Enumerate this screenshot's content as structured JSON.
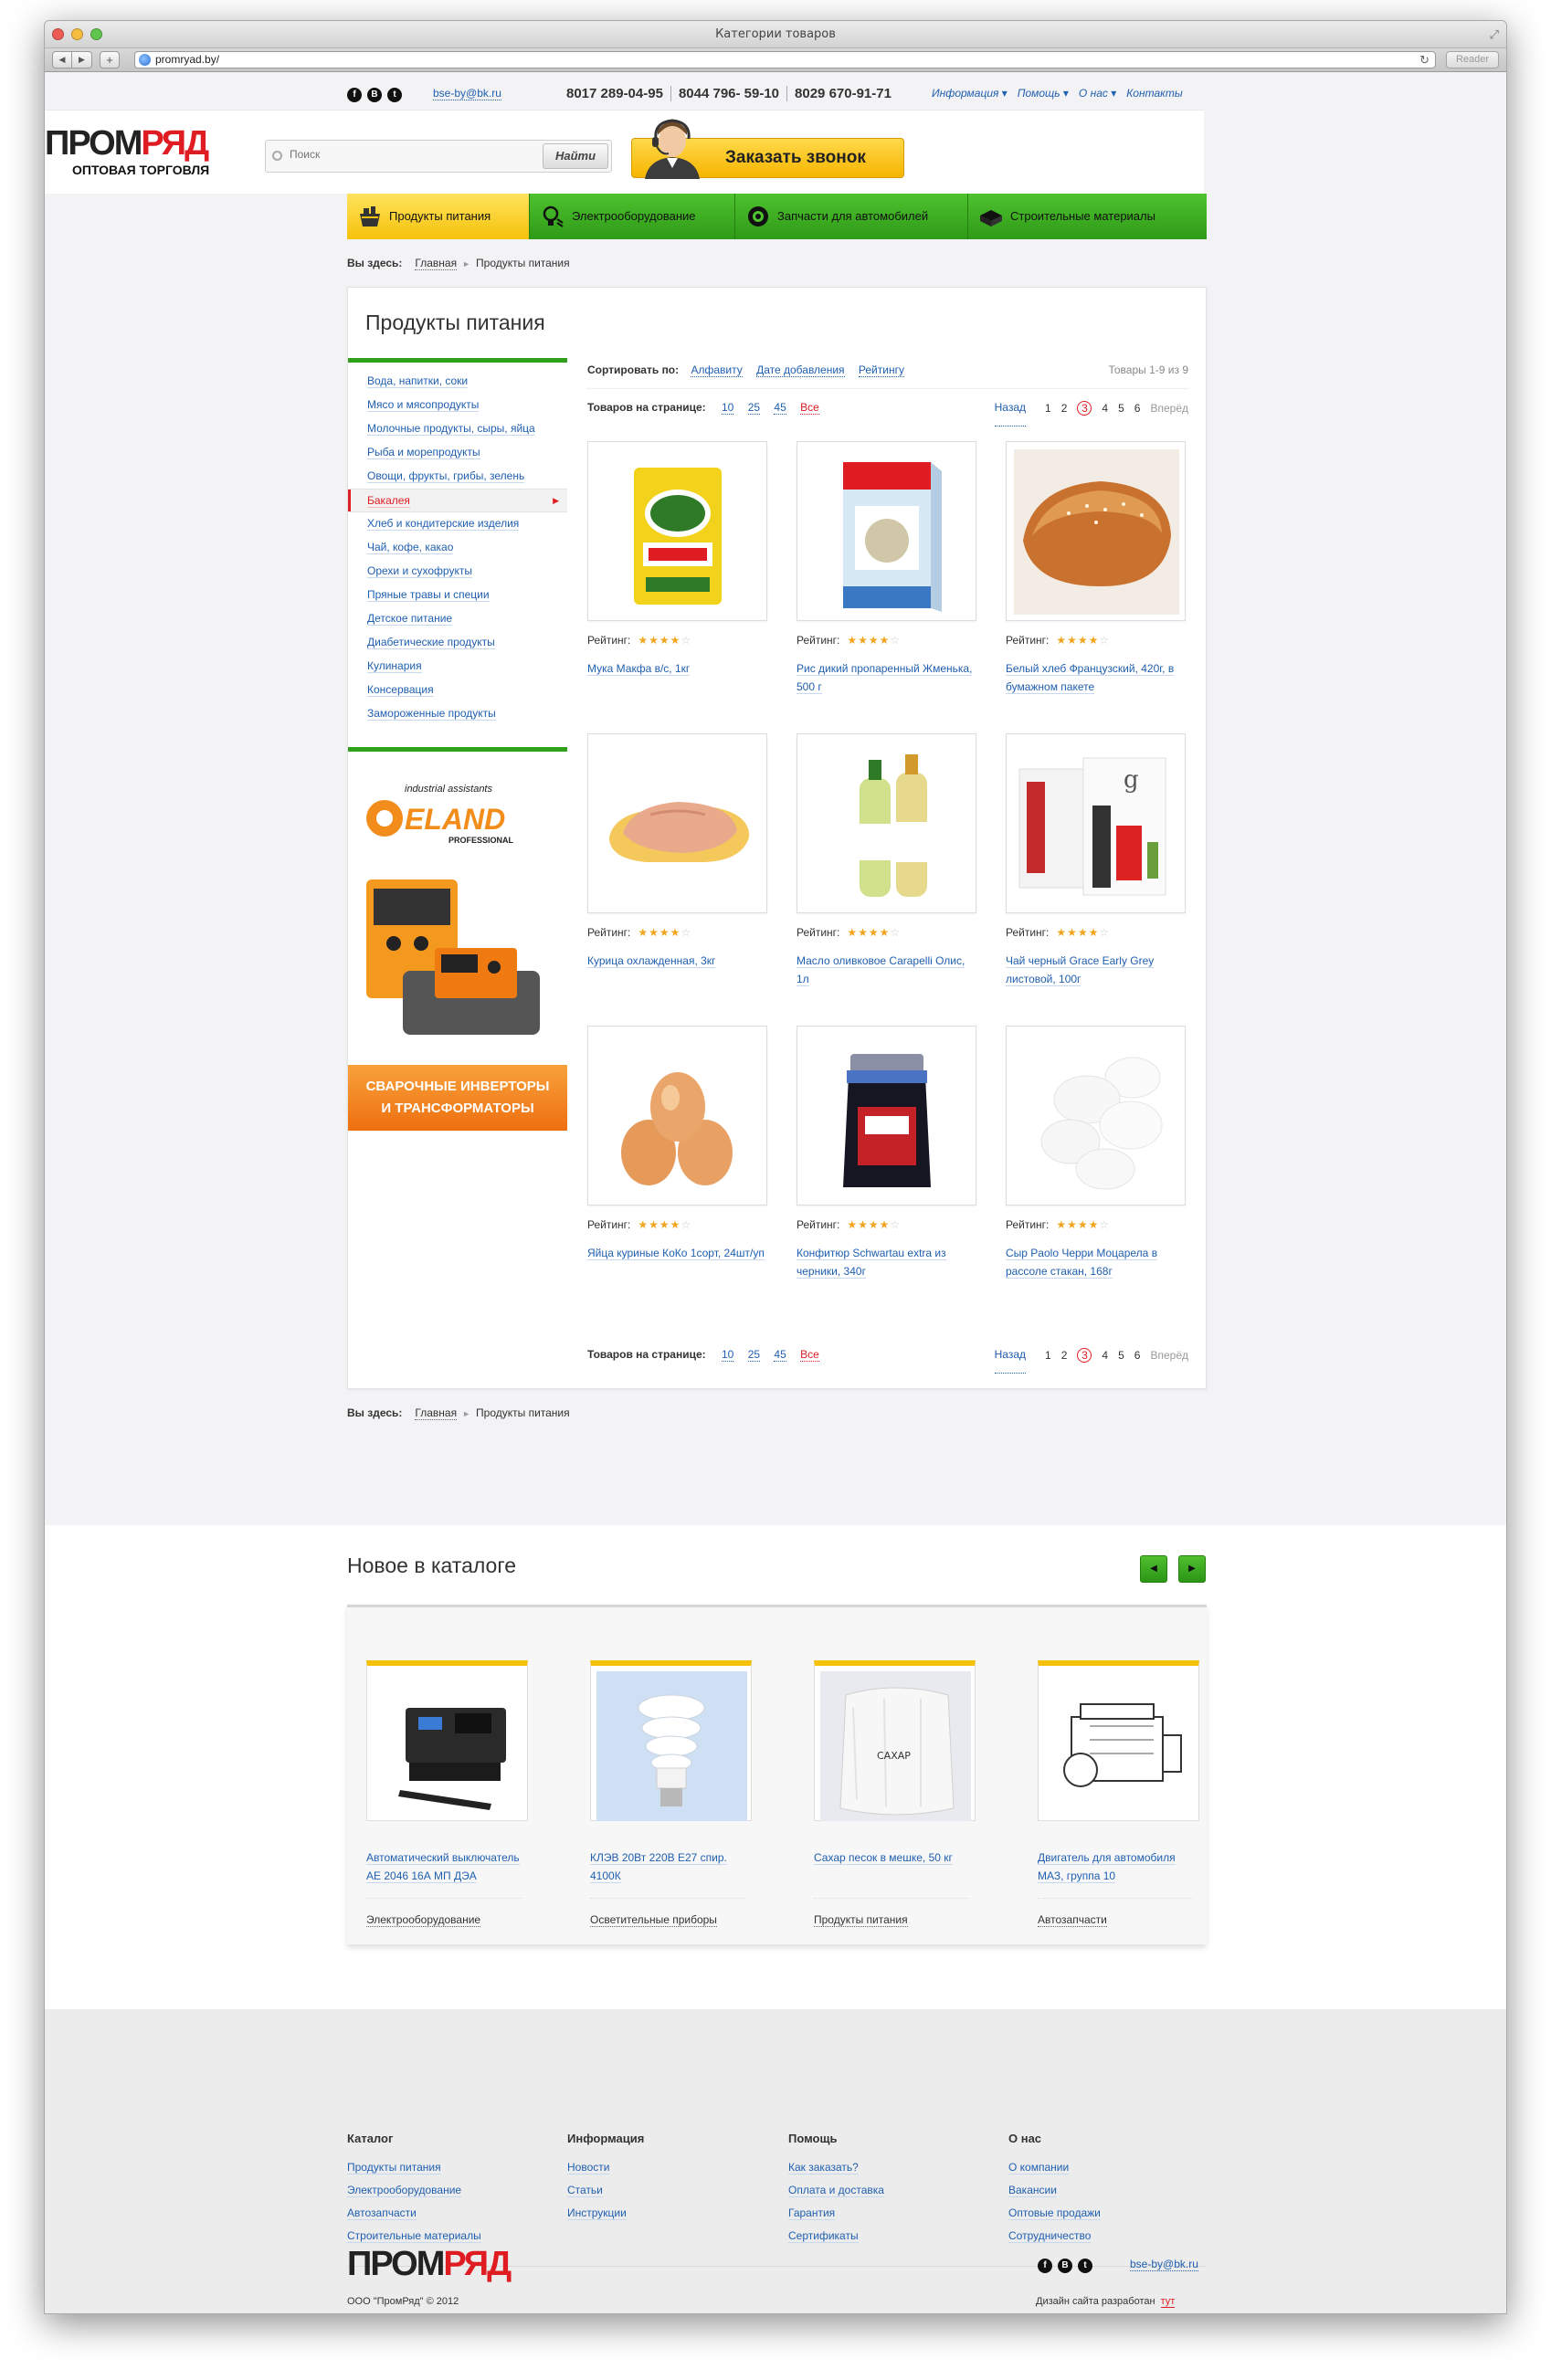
{
  "window": {
    "title": "Категории товаров",
    "url": "promryad.by/",
    "reader_label": "Reader"
  },
  "topbar": {
    "social": [
      "f",
      "B",
      "t"
    ],
    "email": "bse-by@bk.ru",
    "phones": [
      "8017 289-04-95",
      "8044 796- 59-10",
      "8029 670-91-71"
    ],
    "nav": [
      "Информация",
      "Помощь",
      "О нас",
      "Контакты"
    ]
  },
  "header": {
    "logo_part1": "ПРОМ",
    "logo_part2": "РЯД",
    "logo_sub": "ОПТОВАЯ ТОРГОВЛЯ",
    "search_placeholder": "Поиск",
    "search_button": "Найти",
    "callback_button": "Заказать звонок"
  },
  "categories": [
    {
      "label": "Продукты питания",
      "active": true
    },
    {
      "label": "Электрооборудование",
      "active": false
    },
    {
      "label": "Запчасти для автомобилей",
      "active": false
    },
    {
      "label": "Строительные материалы",
      "active": false
    }
  ],
  "breadcrumb": {
    "prefix": "Вы здесь:",
    "home": "Главная",
    "current": "Продукты питания"
  },
  "page_title": "Продукты питания",
  "sidebar": [
    "Вода, напитки, соки",
    "Мясо и мясопродукты",
    "Молочные продукты, сыры, яйца",
    "Рыба и морепродукты",
    "Овощи, фрукты, грибы, зелень",
    "Бакалея",
    "Хлеб и кондитерские изделия",
    "Чай, кофе, какао",
    "Орехи и сухофрукты",
    "Пряные травы и специи",
    "Детское питание",
    "Диабетические продукты",
    "Кулинария",
    "Консервация",
    "Замороженные продукты"
  ],
  "sidebar_active_index": 5,
  "banner": {
    "brand_top": "industrial assistants",
    "brand": "ELAND",
    "brand_sub": "PROFESSIONAL",
    "line1": "СВАРОЧНЫЕ ИНВЕРТОРЫ",
    "line2": "И ТРАНСФОРМАТОРЫ"
  },
  "sort": {
    "label": "Сортировать по:",
    "options": [
      "Алфавиту",
      "Дате добавления",
      "Рейтингу"
    ],
    "count_text": "Товары 1-9 из 9"
  },
  "perpage": {
    "label": "Товаров на странице:",
    "options": [
      "10",
      "25",
      "45",
      "Все"
    ],
    "prev": "Назад",
    "pages": [
      "1",
      "2",
      "3",
      "4",
      "5",
      "6"
    ],
    "current_page": "3",
    "next": "Вперёд"
  },
  "rating_label": "Рейтинг:",
  "products": [
    {
      "title": "Мука Макфа в/с, 1кг",
      "stars": 4,
      "image": "flour-pack"
    },
    {
      "title": "Рис дикий пропаренный Жменька, 500 г",
      "stars": 4,
      "image": "rice-box"
    },
    {
      "title": "Белый хлеб Французский, 420г, в бумажном пакете",
      "stars": 4,
      "image": "bread"
    },
    {
      "title": "Курица охлажденная, 3кг",
      "stars": 4,
      "image": "chicken"
    },
    {
      "title": "Масло оливковое Carapelli Олис, 1л",
      "stars": 4,
      "image": "oil-bottles"
    },
    {
      "title": "Чай черный Grace Early Grey листовой, 100г",
      "stars": 4,
      "image": "tea-boxes"
    },
    {
      "title": "Яйца куриные КоКо 1сорт, 24шт/уп",
      "stars": 4,
      "image": "eggs"
    },
    {
      "title": "Конфитюр Schwartau extra из черники, 340г",
      "stars": 4,
      "image": "jam-jar"
    },
    {
      "title": "Сыр Paolo Черри Моцарела в рассоле стакан, 168г",
      "stars": 4,
      "image": "mozzarella"
    }
  ],
  "novelties": {
    "title": "Новое в каталоге",
    "items": [
      {
        "title": "Автоматический выключатель АЕ 2046 16А МП ДЭА",
        "category": "Электрооборудование",
        "image": "breaker"
      },
      {
        "title": "КЛЭВ 20Вт 220В Е27 спир. 4100К",
        "category": "Осветительные приборы",
        "image": "lamp"
      },
      {
        "title": "Сахар песок в мешке, 50 кг",
        "category": "Продукты питания",
        "image": "sugar-bag"
      },
      {
        "title": "Двигатель для автомобиля МАЗ, группа 10",
        "category": "Автозапчасти",
        "image": "engine"
      }
    ]
  },
  "footer": {
    "columns": [
      {
        "title": "Каталог",
        "links": [
          "Продукты питания",
          "Электрооборудование",
          "Автозапчасти",
          "Строительные материалы"
        ]
      },
      {
        "title": "Информация",
        "links": [
          "Новости",
          "Статьи",
          "Инструкции"
        ]
      },
      {
        "title": "Помощь",
        "links": [
          "Как заказать?",
          "Оплата и доставка",
          "Гарантия",
          "Сертификаты"
        ]
      },
      {
        "title": "О нас",
        "links": [
          "О компании",
          "Вакансии",
          "Оптовые продажи",
          "Сотрудничество"
        ]
      }
    ],
    "email": "bse-by@bk.ru",
    "copyright": "ООО \"ПромРяд\" © 2012",
    "design_text": "Дизайн сайта разработан",
    "design_link": "тут"
  },
  "colors": {
    "accent_red": "#e01c23",
    "nav_green": "#2e9a17",
    "active_yellow": "#f6c10a",
    "link_blue": "#1f5fb0"
  }
}
